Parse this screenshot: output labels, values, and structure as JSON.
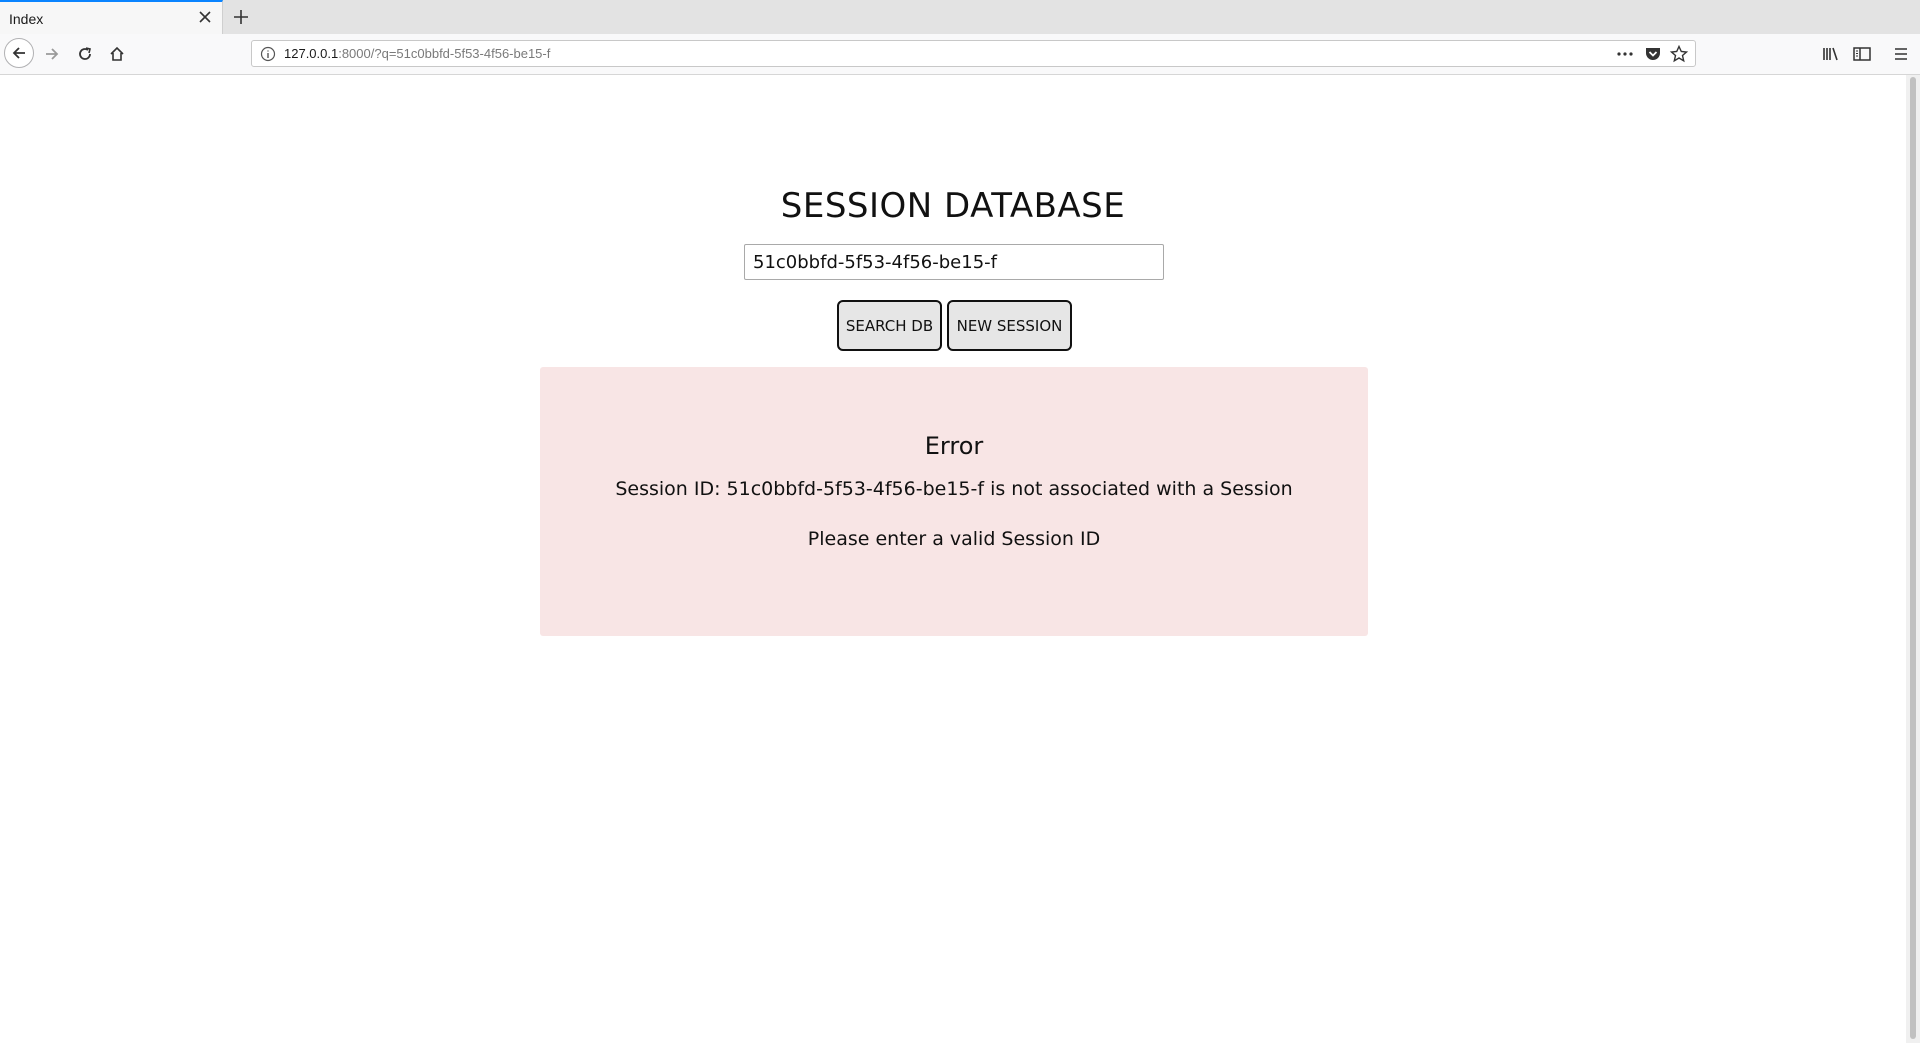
{
  "browser": {
    "tab_title": "Index",
    "url_host": "127.0.0.1",
    "url_rest": ":8000/?q=51c0bbfd-5f53-4f56-be15-f"
  },
  "page": {
    "title": "SESSION DATABASE",
    "search_value": "51c0bbfd-5f53-4f56-be15-f",
    "search_button": "SEARCH DB",
    "new_session_button": "NEW SESSION"
  },
  "error": {
    "title": "Error",
    "message": "Session ID: 51c0bbfd-5f53-4f56-be15-f is not associated with a Session",
    "hint": "Please enter a valid Session ID"
  },
  "colors": {
    "error_background": "#f8e5e5",
    "button_background": "#e6e6e6",
    "tab_accent": "#0a84ff"
  }
}
